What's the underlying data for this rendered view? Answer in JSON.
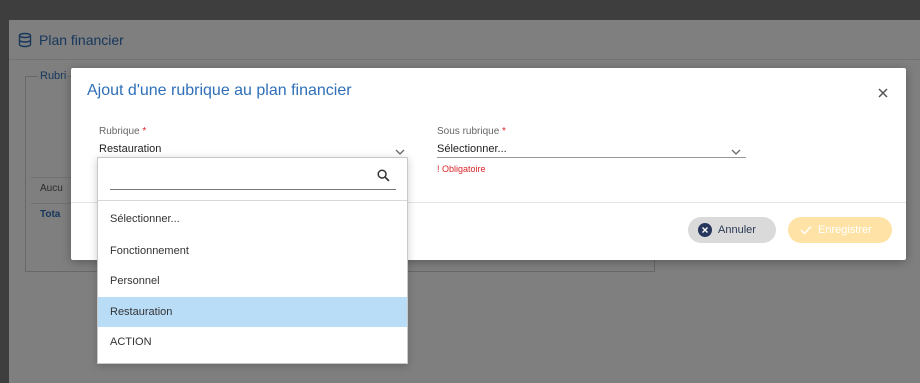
{
  "background": {
    "header_title": "Plan financier",
    "legend": "Rubri",
    "row1": "Aucu",
    "row2": "Tota"
  },
  "modal": {
    "title": "Ajout d'une rubrique au plan financier",
    "rubrique": {
      "label": "Rubrique",
      "required_mark": "*",
      "value": "Restauration"
    },
    "sous_rubrique": {
      "label": "Sous rubrique",
      "required_mark": "*",
      "value": "Sélectionner...",
      "error": "! Obligatoire"
    },
    "cancel_label": "Annuler",
    "save_label": "Enregistrer"
  },
  "dropdown": {
    "search_value": "",
    "options": [
      "Sélectionner...",
      "Fonctionnement",
      "Personnel",
      "Restauration",
      "ACTION"
    ],
    "selected": "Restauration"
  },
  "colors": {
    "accent": "#2e6fb7",
    "error": "#d9262c",
    "selected_bg": "#b9ddf7",
    "save_disabled": "#ffe3a6",
    "cancel_icon": "#27365c"
  },
  "icons": {
    "header": "database-icon",
    "close": "close-icon",
    "chevron": "chevron-down-icon",
    "search": "search-icon",
    "cancel": "x-circle-icon",
    "save": "check-icon"
  }
}
